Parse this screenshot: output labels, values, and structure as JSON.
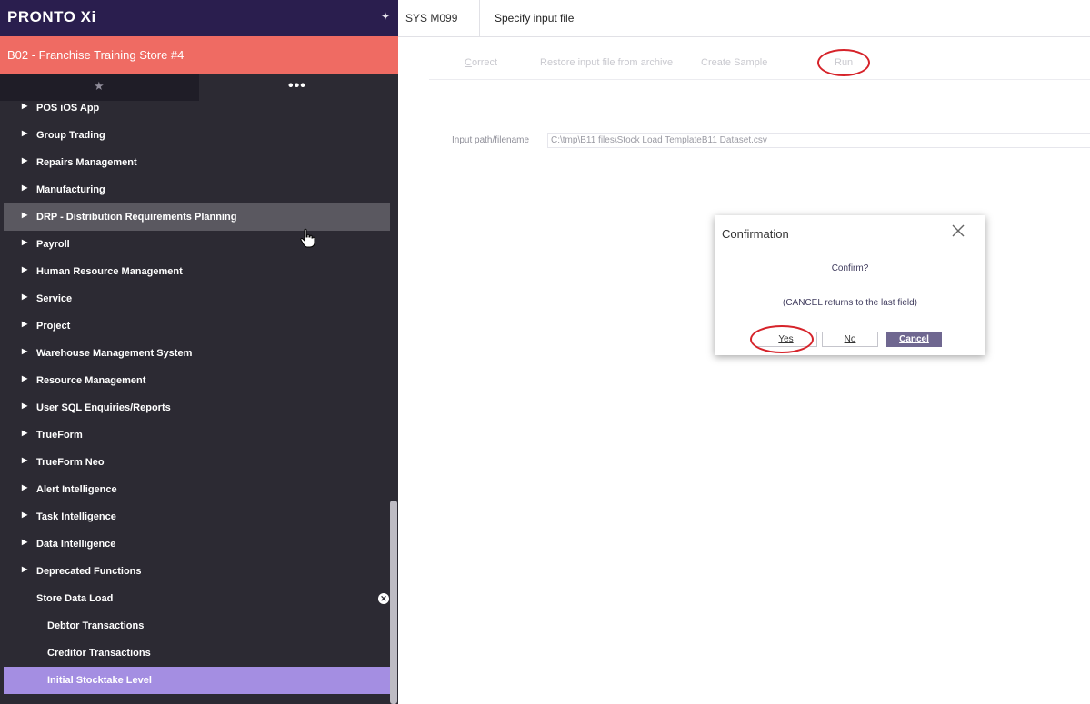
{
  "app": {
    "logo_text": "PRONTO Xi",
    "pin_glyph": "✦",
    "store": "B02 - Franchise Training Store #4",
    "tab_favorites_glyph": "★",
    "tab_more_glyph": "•••"
  },
  "menu": {
    "items": [
      {
        "label": "POS iOS App",
        "expandable": true
      },
      {
        "label": "Group Trading",
        "expandable": true
      },
      {
        "label": "Repairs Management",
        "expandable": true
      },
      {
        "label": "Manufacturing",
        "expandable": true
      },
      {
        "label": "DRP - Distribution Requirements Planning",
        "expandable": true,
        "state": "hover"
      },
      {
        "label": "Payroll",
        "expandable": true
      },
      {
        "label": "Human Resource Management",
        "expandable": true
      },
      {
        "label": "Service",
        "expandable": true
      },
      {
        "label": "Project",
        "expandable": true
      },
      {
        "label": "Warehouse Management System",
        "expandable": true
      },
      {
        "label": "Resource Management",
        "expandable": true
      },
      {
        "label": "User SQL Enquiries/Reports",
        "expandable": true
      },
      {
        "label": "TrueForm",
        "expandable": true
      },
      {
        "label": "TrueForm Neo",
        "expandable": true
      },
      {
        "label": "Alert Intelligence",
        "expandable": true
      },
      {
        "label": "Task Intelligence",
        "expandable": true
      },
      {
        "label": "Data Intelligence",
        "expandable": true
      },
      {
        "label": "Deprecated Functions",
        "expandable": true
      },
      {
        "label": "Store Data Load",
        "expandable": false,
        "closable": true
      },
      {
        "label": "Debtor Transactions",
        "sub": true
      },
      {
        "label": "Creditor Transactions",
        "sub": true
      },
      {
        "label": "Initial Stocktake Level",
        "sub": true,
        "state": "active"
      }
    ]
  },
  "header": {
    "program_code": "SYS M099",
    "program_title": "Specify input file"
  },
  "toolbar": {
    "correct": "Correct",
    "restore": "Restore input file from archive",
    "create_sample": "Create Sample",
    "run": "Run"
  },
  "form": {
    "path_label": "Input path/filename",
    "path_value": "C:\\tmp\\B11 files\\Stock Load TemplateB11 Dataset.csv"
  },
  "dialog": {
    "title": "Confirmation",
    "message": "Confirm?",
    "hint": "(CANCEL returns to the last field)",
    "yes": "Yes",
    "no": "No",
    "cancel": "Cancel"
  },
  "colors": {
    "brand_bar": "#2a1e4e",
    "store_bar": "#ef6b63",
    "sidebar": "#2c2a33",
    "active_item": "#a48ee2",
    "annotation_red": "#d6232a",
    "cancel_button": "#6f6790"
  }
}
